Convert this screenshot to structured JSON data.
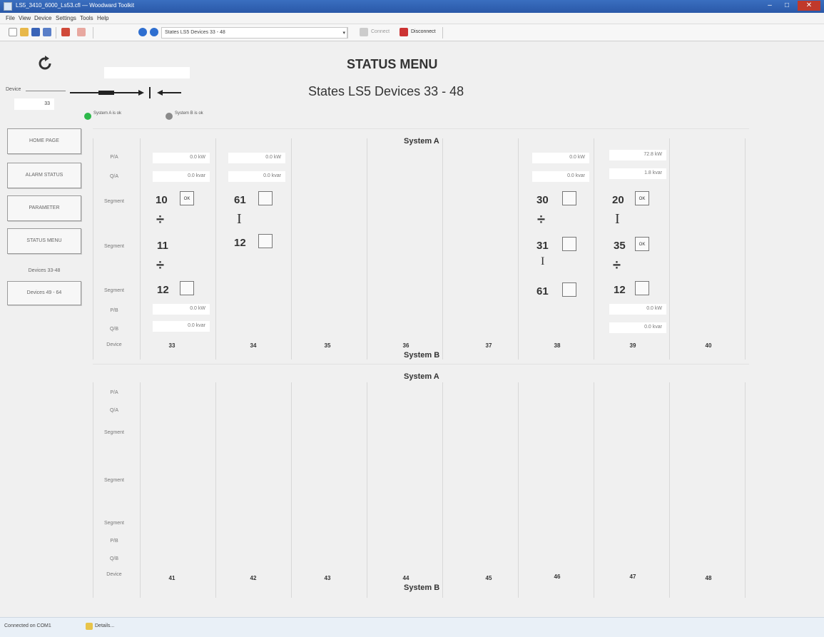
{
  "window": {
    "title": "LS5_3410_6000_Ls53.cfl — Woodward Toolkit"
  },
  "menu": [
    "File",
    "View",
    "Device",
    "Settings",
    "Tools",
    "Help"
  ],
  "toolbar": {
    "view_select": "States LS5 Devices 33 - 48",
    "connect": "Connect",
    "disconnect": "Disconnect"
  },
  "header": {
    "title": "STATUS MENU",
    "subtitle": "States LS5  Devices 33 - 48"
  },
  "device": {
    "label": "Device",
    "value": "33",
    "input_value": ""
  },
  "system_indicators": [
    {
      "label": "System A is ok",
      "color": "#2db84a"
    },
    {
      "label": "System B is ok",
      "color": "#8a8a8a"
    }
  ],
  "nav": [
    "HOME PAGE",
    "ALARM STATUS",
    "PARAMETER",
    "STATUS MENU"
  ],
  "nav_group": {
    "label": "Devices 33-48",
    "button": "Devices 49 - 64"
  },
  "panel_a": {
    "system_top": "System A",
    "system_bottom": "System B",
    "row_labels": [
      "P/A",
      "Q/A",
      "Segment",
      "Segment",
      "Segment",
      "P/B",
      "Q/B",
      "Device"
    ],
    "devices": [
      "33",
      "34",
      "35",
      "36",
      "37",
      "38",
      "39",
      "40"
    ],
    "col1": {
      "pa": "0.0 kW",
      "qa": "0.0 kvar",
      "seg1": "10",
      "seg2": "11",
      "seg3": "12",
      "pb": "0.0 kW",
      "qb": "0.0 kvar",
      "ok": "OK"
    },
    "col2": {
      "pa": "0.0 kW",
      "qa": "0.0 kvar",
      "seg1": "61",
      "seg2": "12"
    },
    "col6": {
      "pa": "0.0 kW",
      "qa": "0.0 kvar",
      "seg1": "30",
      "seg2": "31",
      "seg3": "61"
    },
    "col7": {
      "pa": "72.8 kW",
      "qa": "1.8 kvar",
      "seg1": "20",
      "seg2": "35",
      "seg3": "12",
      "pb": "0.0 kW",
      "qb": "0.0 kvar",
      "ok": "OK"
    }
  },
  "panel_b": {
    "system_top": "System A",
    "system_bottom": "System B",
    "row_labels": [
      "P/A",
      "Q/A",
      "Segment",
      "Segment",
      "Segment",
      "P/B",
      "Q/B",
      "Device"
    ],
    "devices": [
      "41",
      "42",
      "43",
      "44",
      "45",
      "46",
      "47",
      "48"
    ]
  },
  "status_bar": {
    "text": "Connected on COM1",
    "details": "Details..."
  }
}
